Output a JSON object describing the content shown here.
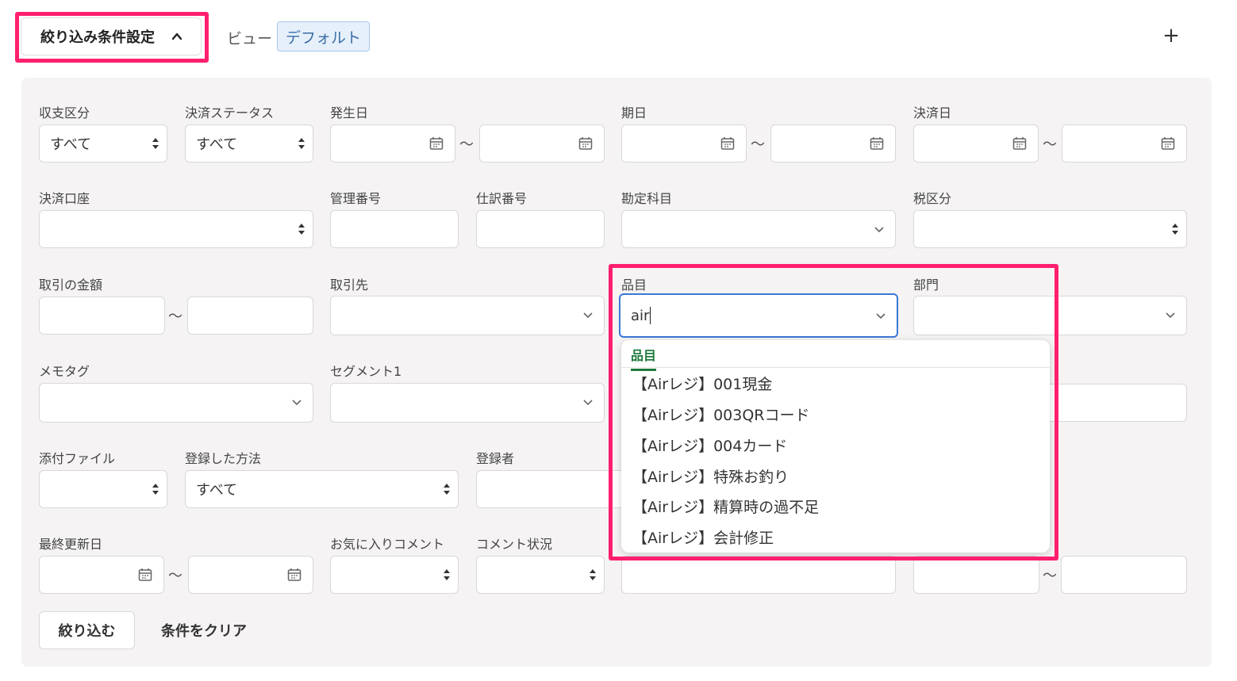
{
  "header": {
    "filter_toggle": "絞り込み条件設定",
    "view_label": "ビュー",
    "view_value": "デフォルト",
    "add": "+"
  },
  "filters": {
    "income_type": {
      "label": "収支区分",
      "value": "すべて"
    },
    "payment_status": {
      "label": "決済ステータス",
      "value": "すべて"
    },
    "issue_date": {
      "label": "発生日"
    },
    "due_date": {
      "label": "期日"
    },
    "payment_date": {
      "label": "決済日"
    },
    "payment_account": {
      "label": "決済口座"
    },
    "management_no": {
      "label": "管理番号"
    },
    "journal_no": {
      "label": "仕訳番号"
    },
    "account_item": {
      "label": "勘定科目"
    },
    "tax_category": {
      "label": "税区分"
    },
    "amount": {
      "label": "取引の金額"
    },
    "partner": {
      "label": "取引先"
    },
    "item": {
      "label": "品目",
      "value": "air"
    },
    "department": {
      "label": "部門"
    },
    "memo_tag": {
      "label": "メモタグ"
    },
    "segment1": {
      "label": "セグメント1"
    },
    "attachment": {
      "label": "添付ファイル"
    },
    "register_method": {
      "label": "登録した方法",
      "value": "すべて"
    },
    "registrant": {
      "label": "登録者"
    },
    "last_updated": {
      "label": "最終更新日"
    },
    "favorite_comment": {
      "label": "お気に入りコメント"
    },
    "comment_status": {
      "label": "コメント状況"
    },
    "tilde": "〜"
  },
  "actions": {
    "apply": "絞り込む",
    "clear": "条件をクリア"
  },
  "dropdown": {
    "tab": "品目",
    "options": [
      "【Airレジ】001現金",
      "【Airレジ】003QRコード",
      "【Airレジ】004カード",
      "【Airレジ】特殊お釣り",
      "【Airレジ】精算時の過不足",
      "【Airレジ】会計修正"
    ]
  },
  "colors": {
    "highlight": "#ff1f6e",
    "focus": "#3a78d8",
    "tab_accent": "#1d7a3c"
  }
}
